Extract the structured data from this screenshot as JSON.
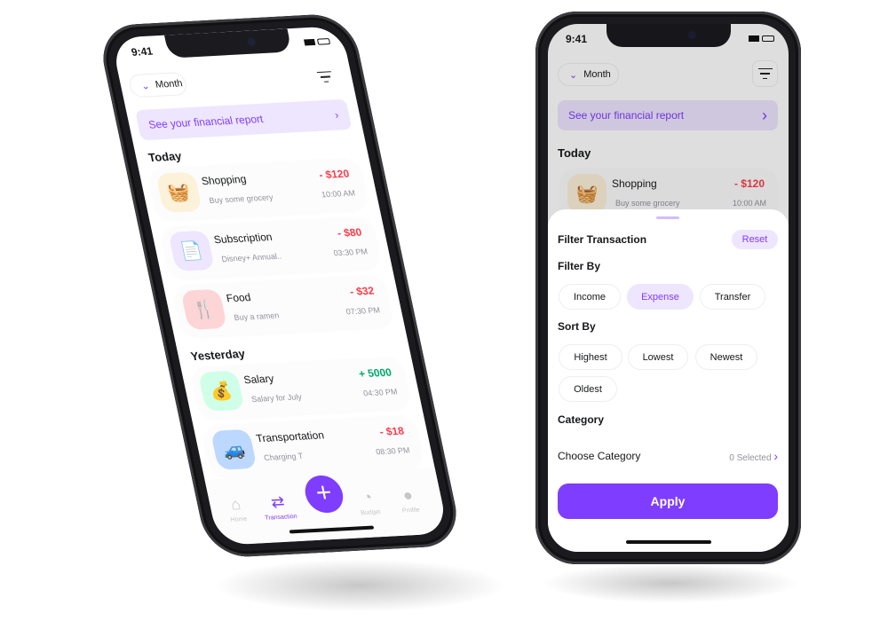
{
  "status": {
    "time": "9:41"
  },
  "header": {
    "period_label": "Month",
    "filter_icon": "filter-icon"
  },
  "banner": {
    "label": "See your financial report"
  },
  "sections": {
    "today": "Today",
    "yesterday": "Yesterday"
  },
  "transactions": [
    {
      "title": "Shopping",
      "note": "Buy some grocery",
      "amount": "- $120",
      "time": "10:00 AM",
      "icon": "shopping-basket-icon",
      "color": "#fcac12",
      "bg": "#fcf1d9"
    },
    {
      "title": "Subscription",
      "note": "Disney+ Annual..",
      "amount": "- $80",
      "time": "03:30 PM",
      "icon": "subscription-icon",
      "color": "#7f3dff",
      "bg": "#eee5ff"
    },
    {
      "title": "Food",
      "note": "Buy a ramen",
      "amount": "- $32",
      "time": "07:30 PM",
      "icon": "food-icon",
      "color": "#fd3c4a",
      "bg": "#fdd5d7"
    },
    {
      "title": "Salary",
      "note": "Salary for July",
      "amount": "+ 5000",
      "time": "04:30 PM",
      "icon": "money-bag-icon",
      "color": "#00a86b",
      "bg": "#cfffe8"
    },
    {
      "title": "Transportation",
      "note": "Charging T",
      "amount": "- $18",
      "time": "08:30 PM",
      "icon": "car-icon",
      "color": "#0077ff",
      "bg": "#bdd8ff"
    }
  ],
  "nav": {
    "home": "Home",
    "transaction": "Transaction",
    "add": "+",
    "budget": "Budget",
    "profile": "Profile"
  },
  "filter": {
    "title": "Filter Transaction",
    "reset": "Reset",
    "filter_by": "Filter By",
    "filter_options": [
      "Income",
      "Expense",
      "Transfer"
    ],
    "filter_selected": "Expense",
    "sort_by": "Sort By",
    "sort_options": [
      "Highest",
      "Lowest",
      "Newest",
      "Oldest"
    ],
    "category": "Category",
    "choose_category": "Choose Category",
    "selected_count": "0 Selected",
    "apply": "Apply"
  },
  "colors": {
    "accent": "#7f3dff",
    "expense": "#fd3c4a",
    "income": "#00a86b"
  }
}
